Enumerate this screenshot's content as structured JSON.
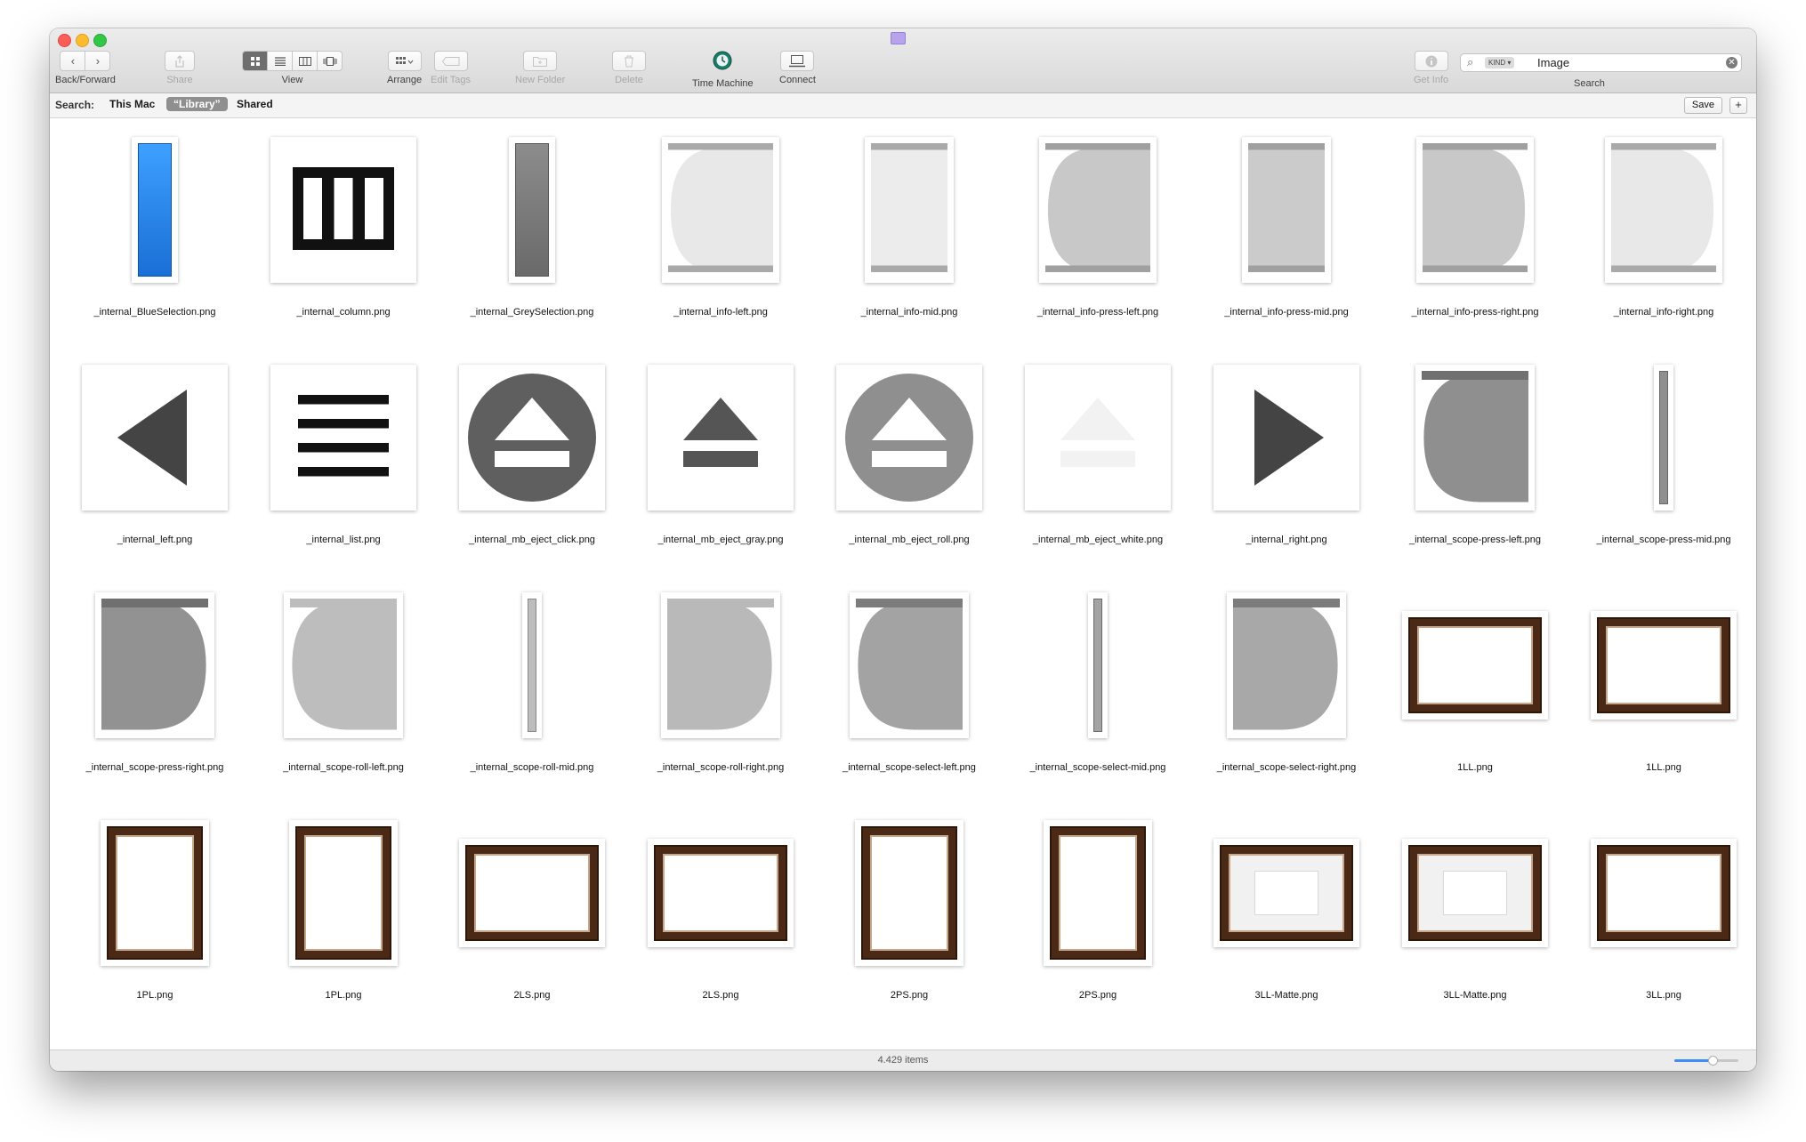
{
  "toolbar": {
    "back_forward_label": "Back/Forward",
    "share_label": "Share",
    "view_label": "View",
    "arrange_label": "Arrange",
    "edit_tags_label": "Edit Tags",
    "new_folder_label": "New Folder",
    "delete_label": "Delete",
    "time_machine_label": "Time Machine",
    "connect_label": "Connect",
    "get_info_label": "Get Info",
    "search_label": "Search"
  },
  "search": {
    "token": "KIND ▾",
    "query": "Image"
  },
  "scope": {
    "label": "Search:",
    "this_mac": "This Mac",
    "library": "“Library”",
    "shared": "Shared",
    "save": "Save",
    "plus": "+"
  },
  "files": [
    {
      "name": "_internal_BlueSelection.png",
      "kind": "blue-bar"
    },
    {
      "name": "_internal_column.png",
      "kind": "column-icon"
    },
    {
      "name": "_internal_GreySelection.png",
      "kind": "grey-bar"
    },
    {
      "name": "_internal_info-left.png",
      "kind": "pill-left-light"
    },
    {
      "name": "_internal_info-mid.png",
      "kind": "pill-mid-light"
    },
    {
      "name": "_internal_info-press-left.png",
      "kind": "pill-left-grey"
    },
    {
      "name": "_internal_info-press-mid.png",
      "kind": "pill-mid-grey"
    },
    {
      "name": "_internal_info-press-right.png",
      "kind": "pill-right-grey"
    },
    {
      "name": "_internal_info-right.png",
      "kind": "pill-right-light"
    },
    {
      "name": "_internal_left.png",
      "kind": "arrow-left"
    },
    {
      "name": "_internal_list.png",
      "kind": "list-icon"
    },
    {
      "name": "_internal_mb_eject_click.png",
      "kind": "eject-circle-dark"
    },
    {
      "name": "_internal_mb_eject_gray.png",
      "kind": "eject-plain"
    },
    {
      "name": "_internal_mb_eject_roll.png",
      "kind": "eject-circle-grey"
    },
    {
      "name": "_internal_mb_eject_white.png",
      "kind": "eject-white"
    },
    {
      "name": "_internal_right.png",
      "kind": "arrow-right"
    },
    {
      "name": "_internal_scope-press-left.png",
      "kind": "scope-left-dark"
    },
    {
      "name": "_internal_scope-press-mid.png",
      "kind": "scope-mid-dark"
    },
    {
      "name": "_internal_scope-press-right.png",
      "kind": "scope-right-dark"
    },
    {
      "name": "_internal_scope-roll-left.png",
      "kind": "scope-left-light"
    },
    {
      "name": "_internal_scope-roll-mid.png",
      "kind": "scope-mid-light"
    },
    {
      "name": "_internal_scope-roll-right.png",
      "kind": "scope-right-light"
    },
    {
      "name": "_internal_scope-select-left.png",
      "kind": "scope-left-mid"
    },
    {
      "name": "_internal_scope-select-mid.png",
      "kind": "scope-mid-mid"
    },
    {
      "name": "_internal_scope-select-right.png",
      "kind": "scope-right-mid"
    },
    {
      "name": "1LL.png",
      "kind": "frame-landscape"
    },
    {
      "name": "1LL.png",
      "kind": "frame-landscape"
    },
    {
      "name": "1PL.png",
      "kind": "frame-portrait"
    },
    {
      "name": "1PL.png",
      "kind": "frame-portrait"
    },
    {
      "name": "2LS.png",
      "kind": "frame-landscape-small"
    },
    {
      "name": "2LS.png",
      "kind": "frame-landscape-small"
    },
    {
      "name": "2PS.png",
      "kind": "frame-portrait-small"
    },
    {
      "name": "2PS.png",
      "kind": "frame-portrait-small"
    },
    {
      "name": "3LL-Matte.png",
      "kind": "frame-matte"
    },
    {
      "name": "3LL-Matte.png",
      "kind": "frame-matte"
    },
    {
      "name": "3LL.png",
      "kind": "frame-landscape"
    }
  ],
  "status": {
    "item_count": "4.429 items",
    "icon_size_fraction": 0.6
  },
  "colors": {
    "selection_blue": "#2a7fe0",
    "frame_wood": "#4a2a16",
    "time_machine_green": "#1c7c6b"
  }
}
